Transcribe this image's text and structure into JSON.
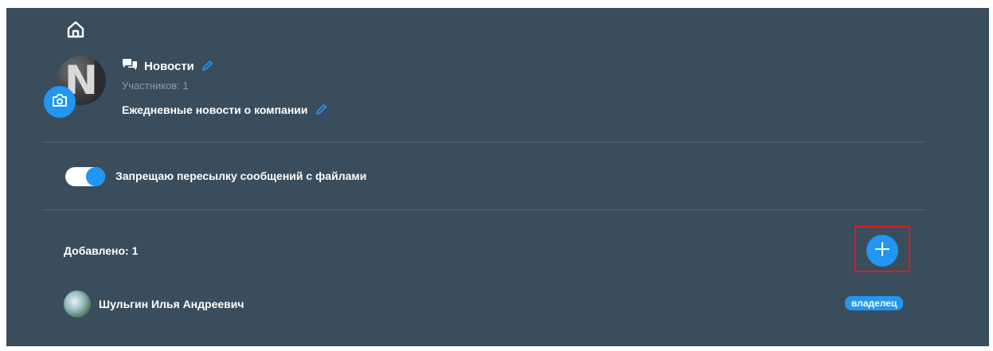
{
  "nav": {
    "home_icon": "home-icon"
  },
  "group": {
    "title": "Новости",
    "title_icon": "chat-bubbles-icon",
    "members_label": "Участников: 1",
    "description": "Ежедневные новости о компании",
    "avatar_letter": "N",
    "edit_icon": "pencil-icon",
    "camera_icon": "camera-icon"
  },
  "settings": {
    "forward_files_toggle": {
      "label": "Запрещаю пересылку сообщений с файлами",
      "on": true
    }
  },
  "members_section": {
    "added_label": "Добавлено: 1",
    "add_button_icon": "plus-icon",
    "members": [
      {
        "name": "Шульгин Илья Андреевич",
        "role": "владелец"
      }
    ]
  },
  "colors": {
    "background": "#3a4d5c",
    "accent": "#2196f3",
    "muted_text": "#8a9baa",
    "highlight": "#e01b1b"
  }
}
